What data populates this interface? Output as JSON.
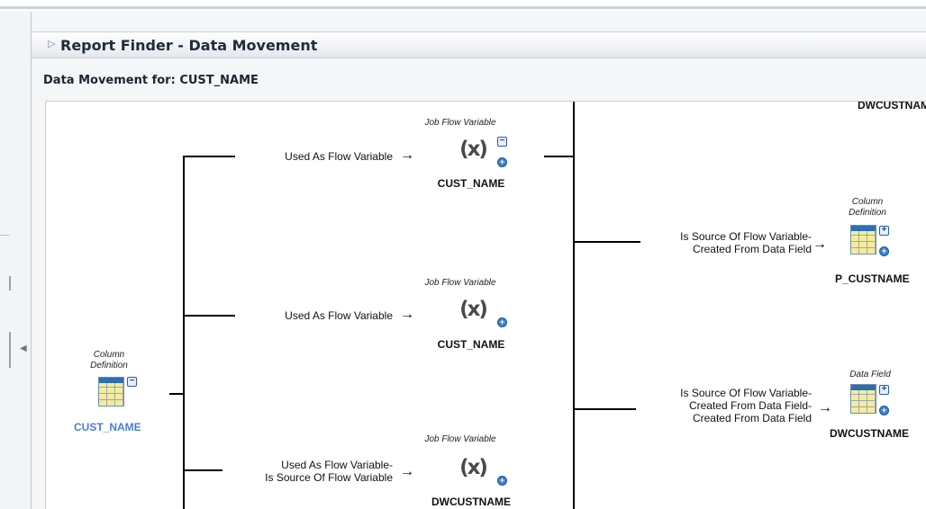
{
  "panel": {
    "title": "Report Finder - Data Movement",
    "subheading": "Data Movement for: CUST_NAME"
  },
  "root": {
    "type": "Column Definition",
    "name": "CUST_NAME"
  },
  "edges": [
    "Used As Flow Variable",
    "Used As Flow Variable",
    "Used As Flow Variable-\nIs Source Of Flow Variable",
    "Is Source Of Flow Variable-\nCreated From Data Field",
    "Is Source Of Flow Variable-\nCreated From Data Field-\nCreated From Data Field"
  ],
  "level1": [
    {
      "type": "Job Flow Variable",
      "name": "CUST_NAME"
    },
    {
      "type": "Job Flow Variable",
      "name": "CUST_NAME"
    },
    {
      "type": "Job Flow Variable",
      "name": "DWCUSTNAME"
    }
  ],
  "level2": [
    {
      "type": "",
      "name": "DWCUSTNAME"
    },
    {
      "type": "Column Definition",
      "name": "P_CUSTNAME"
    },
    {
      "type": "Data Field",
      "name": "DWCUSTNAME"
    }
  ],
  "icons": {
    "arrow": "→",
    "expand": "+",
    "collapse": "−",
    "panel_toggle": "▷",
    "side_collapse": "◀"
  }
}
